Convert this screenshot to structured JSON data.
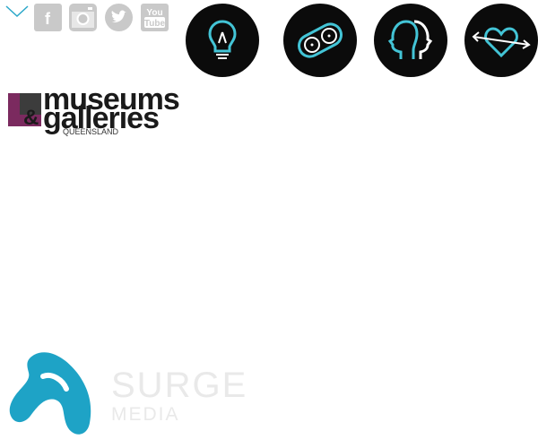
{
  "nav": {
    "toggle_icon": "chevron-down-icon",
    "color": "#2aa7c9"
  },
  "social": [
    {
      "name": "facebook-icon",
      "glyph": "f"
    },
    {
      "name": "instagram-icon",
      "glyph": ""
    },
    {
      "name": "twitter-icon",
      "glyph": ""
    },
    {
      "name": "youtube-icon",
      "glyph_top": "You",
      "glyph_bottom": "Tube"
    }
  ],
  "social_color": "#c9c9c9",
  "categories": [
    {
      "name": "lightbulb-icon"
    },
    {
      "name": "film-reel-icon"
    },
    {
      "name": "heads-profile-icon"
    },
    {
      "name": "heart-arrow-icon"
    }
  ],
  "accent": "#43c4d6",
  "logo": {
    "line1": "museums",
    "amp": "&",
    "line2": "galleries",
    "sub": "QUEENSLAND",
    "colors": {
      "square": "#7b2a5f",
      "text": "#1a1a1a"
    }
  },
  "footer_logo": {
    "word1": "SURGE",
    "word2": "MEDIA",
    "mark_color": "#1ea3c6",
    "text_color": "#e9e9e9"
  }
}
